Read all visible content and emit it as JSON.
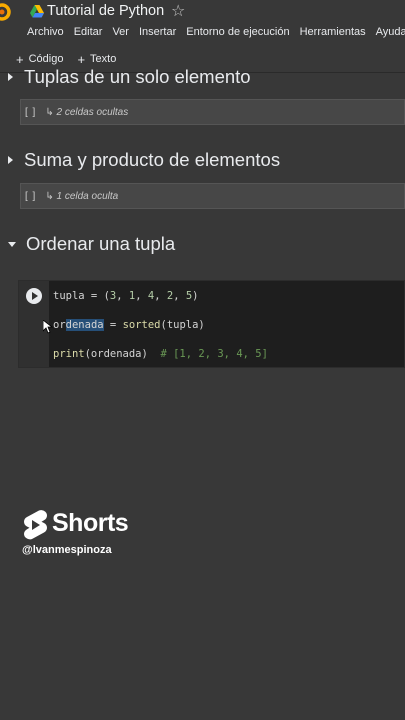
{
  "header": {
    "title": "Tutorial de Python",
    "logo_icon": "colab-logo",
    "drive_icon": "google-drive-icon",
    "star_icon": "star-outline-icon",
    "accent": "#f9ab00"
  },
  "menu": {
    "items": [
      "Archivo",
      "Editar",
      "Ver",
      "Insertar",
      "Entorno de ejecución",
      "Herramientas",
      "Ayuda"
    ]
  },
  "toolbar": {
    "code_label": "Código",
    "text_label": "Texto"
  },
  "sections": [
    {
      "title": "Tuplas de un solo elemento",
      "collapsed": true,
      "hidden_brackets": "[ ]",
      "hidden_label": "↳ 2 celdas ocultas"
    },
    {
      "title": "Suma y producto de elementos",
      "collapsed": true,
      "hidden_brackets": "[ ]",
      "hidden_label": "↳ 1 celda oculta"
    },
    {
      "title": "Ordenar una tupla",
      "collapsed": false
    }
  ],
  "code_cell": {
    "line1": {
      "a": "tupla",
      "b": " = (",
      "c": "3",
      "d": ", ",
      "e": "1",
      "f": ", ",
      "g": "4",
      "h": ", ",
      "i": "2",
      "j": ", ",
      "k": "5",
      "l": ")"
    },
    "line2": {
      "a": "or",
      "b": "denada",
      "c": " = ",
      "d": "sorted",
      "e": "(tupla)"
    },
    "line3": {
      "a": "print",
      "b": "(ordenada)  ",
      "c": "# [1, 2, 3, 4, 5]"
    },
    "colors": {
      "background": "#1e1e1e",
      "number": "#b5cea8",
      "function": "#dcdcaa",
      "comment": "#6a9955",
      "selection": "#264f78"
    }
  },
  "watermark": {
    "brand": "Shorts",
    "handle": "@lvanmespinoza",
    "icon": "youtube-shorts-icon"
  }
}
